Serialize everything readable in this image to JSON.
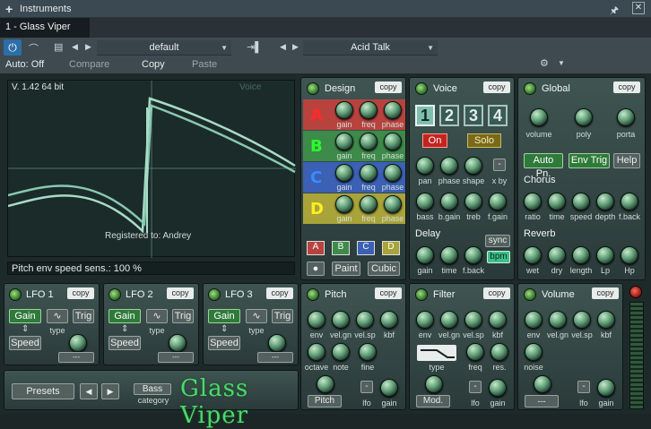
{
  "titlebar": {
    "title": "Instruments"
  },
  "tab": {
    "label": "1 - Glass Viper"
  },
  "toolbar": {
    "preset": "default",
    "auto": "Auto: Off",
    "compare": "Compare",
    "copy": "Copy",
    "paste": "Paste",
    "program": "Acid Talk"
  },
  "scope": {
    "version": "V. 1.42 64 bit",
    "mode": "Voice",
    "registered": "Registered to: Andrey"
  },
  "status": "Pitch env speed sens.: 100 %",
  "design": {
    "title": "Design",
    "copy": "copy",
    "rows": [
      {
        "letter": "A",
        "k": [
          "gain",
          "freq",
          "phase"
        ]
      },
      {
        "letter": "B",
        "k": [
          "gain",
          "freq",
          "phase"
        ]
      },
      {
        "letter": "C",
        "k": [
          "gain",
          "freq",
          "phase"
        ]
      },
      {
        "letter": "D",
        "k": [
          "gain",
          "freq",
          "phase"
        ]
      }
    ],
    "sel": [
      "A",
      "B",
      "C",
      "D"
    ],
    "paint": "Paint",
    "cubic": "Cubic"
  },
  "voice": {
    "title": "Voice",
    "copy": "copy",
    "nums": [
      "1",
      "2",
      "3",
      "4"
    ],
    "on": "On",
    "solo": "Solo",
    "row1": [
      "pan",
      "phase",
      "shape",
      "x by"
    ],
    "minus": "-",
    "row2": [
      "bass",
      "b.gain",
      "treb",
      "f.gain"
    ],
    "delay": "Delay",
    "sync": "sync",
    "bpm": "bpm",
    "row3": [
      "gain",
      "time",
      "f.back"
    ]
  },
  "global": {
    "title": "Global",
    "copy": "copy",
    "k": [
      "volume",
      "poly",
      "porta"
    ],
    "autopn": "Auto Pn.",
    "envtrig": "Env Trig",
    "help": "Help",
    "chorus": "Chorus",
    "ck": [
      "ratio",
      "time",
      "speed",
      "depth",
      "f.back"
    ],
    "reverb": "Reverb",
    "rk": [
      "wet",
      "dry",
      "length",
      "Lp",
      "Hp"
    ]
  },
  "lfos": [
    {
      "title": "LFO 1",
      "copy": "copy",
      "gain": "Gain",
      "trig": "Trig",
      "speed": "Speed",
      "type": "type",
      "dash": "---"
    },
    {
      "title": "LFO 2",
      "copy": "copy",
      "gain": "Gain",
      "trig": "Trig",
      "speed": "Speed",
      "type": "type",
      "dash": "---"
    },
    {
      "title": "LFO 3",
      "copy": "copy",
      "gain": "Gain",
      "trig": "Trig",
      "speed": "Speed",
      "type": "type",
      "dash": "---"
    }
  ],
  "pitch": {
    "title": "Pitch",
    "copy": "copy",
    "r1": [
      "env",
      "vel.gn",
      "vel.sp",
      "kbf"
    ],
    "r2": [
      "octave",
      "note",
      "fine"
    ],
    "btn": "Pitch",
    "lfo": "lfo",
    "gain": "gain",
    "dash": "-"
  },
  "filter": {
    "title": "Filter",
    "copy": "copy",
    "r1": [
      "env",
      "vel.gn",
      "vel.sp",
      "kbf"
    ],
    "r2": [
      "type",
      "freq",
      "res."
    ],
    "btn": "Mod.",
    "lfo": "lfo",
    "gain": "gain",
    "dash": "-"
  },
  "volume": {
    "title": "Volume",
    "copy": "copy",
    "r1": [
      "env",
      "vel.gn",
      "vel.sp",
      "kbf"
    ],
    "noise": "noise",
    "btn": "---",
    "lfo": "lfo",
    "gain": "gain",
    "dash": "-"
  },
  "bottom": {
    "presets": "Presets",
    "bass": "Bass",
    "category": "category",
    "logo": "Glass Viper"
  }
}
